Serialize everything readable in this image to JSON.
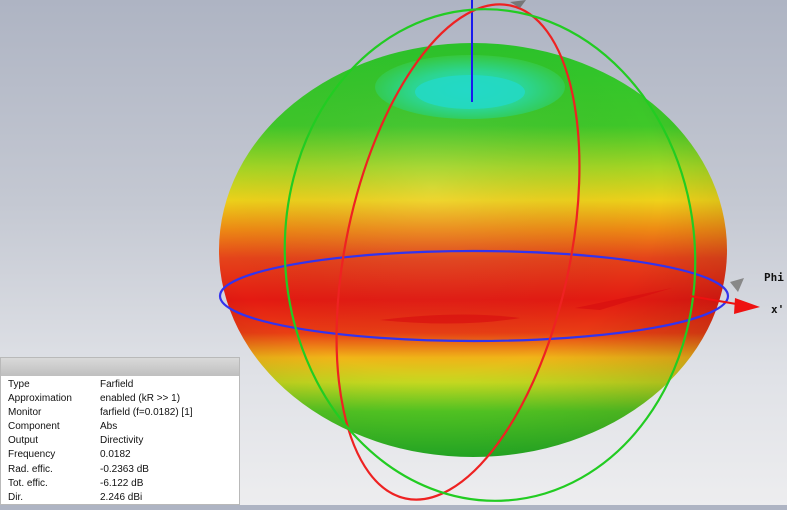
{
  "viewport": {
    "axis_labels": {
      "phi": "Phi",
      "x": "x'"
    },
    "colors": {
      "background_top": "#aeb4c3",
      "background_bottom": "#ededef",
      "pattern_high": "#e41a12",
      "pattern_mid": "#eed21a",
      "pattern_low": "#22c223",
      "pattern_min": "#26d6c0",
      "theta_circle": "#ee2222",
      "phi_circle": "#22cc22",
      "equator_circle": "#3333ee",
      "z_axis": "#1a1aee"
    }
  },
  "info": {
    "rows": [
      {
        "key": "Type",
        "value": "Farfield"
      },
      {
        "key": "Approximation",
        "value": "enabled (kR >> 1)"
      },
      {
        "key": "Monitor",
        "value": "farfield (f=0.0182) [1]"
      },
      {
        "key": "Component",
        "value": "Abs"
      },
      {
        "key": "Output",
        "value": "Directivity"
      },
      {
        "key": "Frequency",
        "value": "0.0182"
      },
      {
        "key": "Rad. effic.",
        "value": "-0.2363 dB"
      },
      {
        "key": "Tot. effic.",
        "value": "-6.122 dB"
      },
      {
        "key": "Dir.",
        "value": "2.246 dBi"
      }
    ]
  }
}
